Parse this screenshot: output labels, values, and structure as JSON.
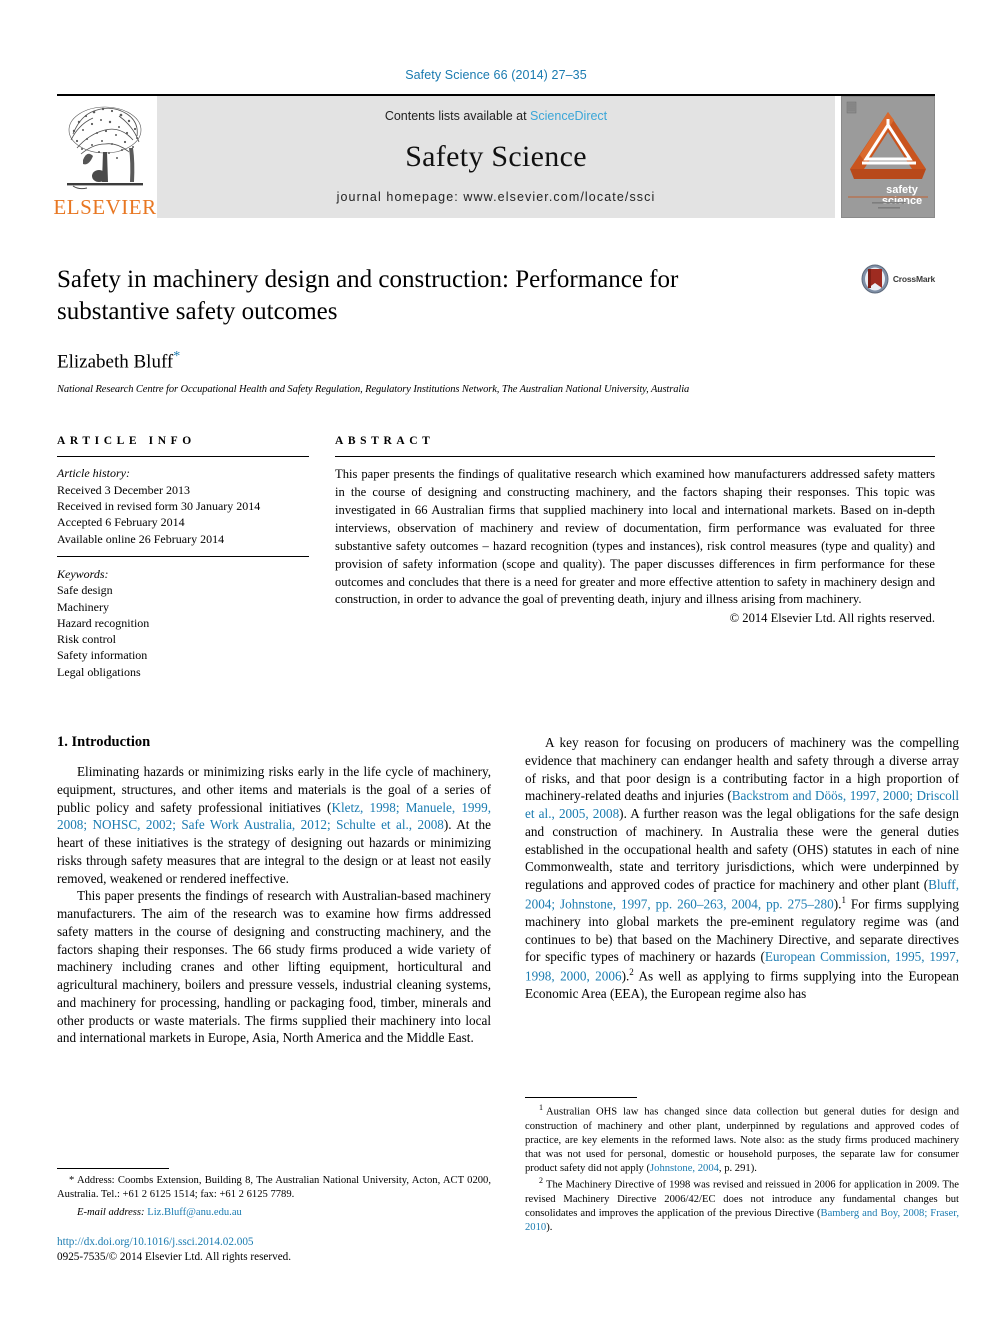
{
  "running_head": "Safety Science 66 (2014) 27–35",
  "masthead": {
    "publisher_name": "ELSEVIER",
    "contents_prefix": "Contents lists available at ",
    "contents_link": "ScienceDirect",
    "journal_title": "Safety Science",
    "homepage_line": "journal homepage: www.elsevier.com/locate/ssci",
    "cover_line1": "safety",
    "cover_line2": "science"
  },
  "article": {
    "title": "Safety in machinery design and construction: Performance for substantive safety outcomes",
    "author": "Elizabeth Bluff",
    "author_marker": "*",
    "affiliation": "National Research Centre for Occupational Health and Safety Regulation, Regulatory Institutions Network, The Australian National University, Australia",
    "crossmark_label": "CrossMark"
  },
  "info": {
    "heading": "ARTICLE INFO",
    "history_label": "Article history:",
    "history": [
      "Received 3 December 2013",
      "Received in revised form 30 January 2014",
      "Accepted 6 February 2014",
      "Available online 26 February 2014"
    ],
    "keywords_label": "Keywords:",
    "keywords": [
      "Safe design",
      "Machinery",
      "Hazard recognition",
      "Risk control",
      "Safety information",
      "Legal obligations"
    ]
  },
  "abstract": {
    "heading": "ABSTRACT",
    "text": "This paper presents the findings of qualitative research which examined how manufacturers addressed safety matters in the course of designing and constructing machinery, and the factors shaping their responses. This topic was investigated in 66 Australian firms that supplied machinery into local and international markets. Based on in-depth interviews, observation of machinery and review of documentation, firm performance was evaluated for three substantive safety outcomes – hazard recognition (types and instances), risk control measures (type and quality) and provision of safety information (scope and quality). The paper discusses differences in firm performance for these outcomes and concludes that there is a need for greater and more effective attention to safety in machinery design and construction, in order to advance the goal of preventing death, injury and illness arising from machinery.",
    "copyright": "© 2014 Elsevier Ltd. All rights reserved."
  },
  "body": {
    "section_heading": "1. Introduction",
    "left_para_1_a": "Eliminating hazards or minimizing risks early in the life cycle of machinery, equipment, structures, and other items and materials is the goal of a series of public policy and safety professional initiatives (",
    "left_para_1_ref": "Kletz, 1998; Manuele, 1999, 2008; NOHSC, 2002; Safe Work Australia, 2012; Schulte et al., 2008",
    "left_para_1_b": "). At the heart of these initiatives is the strategy of designing out hazards or minimizing risks through safety measures that are integral to the design or at least not easily removed, weakened or rendered ineffective.",
    "left_para_2": "This paper presents the findings of research with Australian-based machinery manufacturers. The aim of the research was to examine how firms addressed safety matters in the course of designing and constructing machinery, and the factors shaping their responses. The 66 study firms produced a wide variety of machinery including cranes and other lifting equipment, horticultural and agricultural machinery, boilers and pressure vessels, industrial cleaning systems, and machinery for processing, handling or packaging food, timber, minerals and other products or waste materials. The firms supplied their machinery into local and international markets in Europe, Asia, North America and the Middle East.",
    "right_para_1_a": "A key reason for focusing on producers of machinery was the compelling evidence that machinery can endanger health and safety through a diverse array of risks, and that poor design is a contributing factor in a high proportion of machinery-related deaths and injuries (",
    "right_para_1_ref1": "Backstrom and Döös, 1997, 2000; Driscoll et al., 2005, 2008",
    "right_para_1_b": "). A further reason was the legal obligations for the safe design and construction of machinery. In Australia these were the general duties established in the occupational health and safety (OHS) statutes in each of nine Commonwealth, state and territory jurisdictions, which were underpinned by regulations and approved codes of practice for machinery and other plant (",
    "right_para_1_ref2": "Bluff, 2004; Johnstone, 1997, pp. 260–263, 2004, pp. 275–280",
    "right_para_1_c": ").",
    "right_para_1_fn1": "1",
    "right_para_1_d": " For firms supplying machinery into global markets the pre-eminent regulatory regime was (and continues to be) that based on the Machinery Directive, and separate directives for specific types of machinery or hazards (",
    "right_para_1_ref3": "European Commission, 1995, 1997, 1998, 2000, 2006",
    "right_para_1_e": ").",
    "right_para_1_fn2": "2",
    "right_para_1_f": " As well as applying to firms supplying into the European Economic Area (EEA), the European regime also has"
  },
  "footnotes": {
    "fn1_marker": "1",
    "fn1_a": "Australian OHS law has changed since data collection but general duties for design and construction of machinery and other plant, underpinned by regulations and approved codes of practice, are key elements in the reformed laws. Note also: as the study firms produced machinery that was not used for personal, domestic or household purposes, the separate law for consumer product safety did not apply (",
    "fn1_ref": "Johnstone, 2004",
    "fn1_b": ", p. 291).",
    "fn2_marker": "2",
    "fn2_a": "The Machinery Directive of 1998 was revised and reissued in 2006 for application in 2009. The revised Machinery Directive 2006/42/EC does not introduce any fundamental changes but consolidates and improves the application of the previous Directive (",
    "fn2_ref": "Bamberg and Boy, 2008; Fraser, 2010",
    "fn2_b": ")."
  },
  "correspondence": {
    "marker": "*",
    "address": " Address: Coombs Extension, Building 8, The Australian National University, Acton, ACT 0200, Australia. Tel.: +61 2 6125 1514; fax: +61 2 6125 7789.",
    "email_label": "E-mail address:",
    "email": "Liz.Bluff@anu.edu.au",
    "doi": "http://dx.doi.org/10.1016/j.ssci.2014.02.005",
    "issn_line": "0925-7535/© 2014 Elsevier Ltd. All rights reserved."
  },
  "colors": {
    "link": "#1a7bb0",
    "sciencedirect": "#3aa6d8",
    "elsevier_orange": "#E87722",
    "band_gray": "#e3e3e3",
    "cover_gray": "#9b9b9b"
  }
}
